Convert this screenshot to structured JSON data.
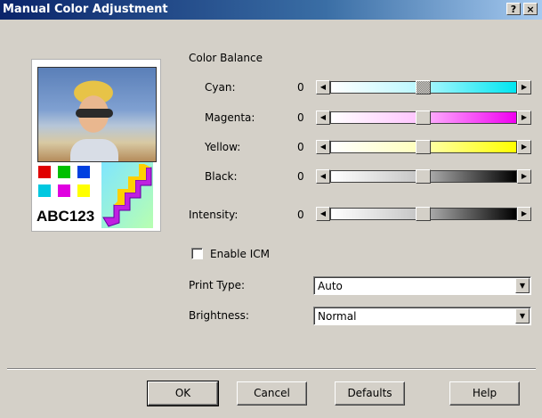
{
  "window": {
    "title": "Manual Color Adjustment",
    "help_label": "?",
    "close_label": "×"
  },
  "preview": {
    "caption": "ABC123",
    "swatch_colors": [
      "#e00000",
      "#00c000",
      "#0040e0",
      "#00c8e0",
      "#e000e0",
      "#ffff00"
    ]
  },
  "color_balance": {
    "heading": "Color Balance",
    "sliders": [
      {
        "label": "Cyan:",
        "value": "0",
        "colors": [
          "#ffffff",
          "#00e6f0"
        ]
      },
      {
        "label": "Magenta:",
        "value": "0",
        "colors": [
          "#ffffff",
          "#f000f0"
        ]
      },
      {
        "label": "Yellow:",
        "value": "0",
        "colors": [
          "#ffffff",
          "#ffff00"
        ]
      },
      {
        "label": "Black:",
        "value": "0",
        "colors": [
          "#ffffff",
          "#000000"
        ]
      }
    ]
  },
  "intensity": {
    "label": "Intensity:",
    "value": "0",
    "colors": [
      "#ffffff",
      "#000000"
    ]
  },
  "enable_icm": {
    "label": "Enable ICM",
    "checked": false
  },
  "print_type": {
    "label": "Print Type:",
    "value": "Auto"
  },
  "brightness": {
    "label": "Brightness:",
    "value": "Normal"
  },
  "buttons": {
    "ok": "OK",
    "cancel": "Cancel",
    "defaults": "Defaults",
    "help": "Help"
  }
}
